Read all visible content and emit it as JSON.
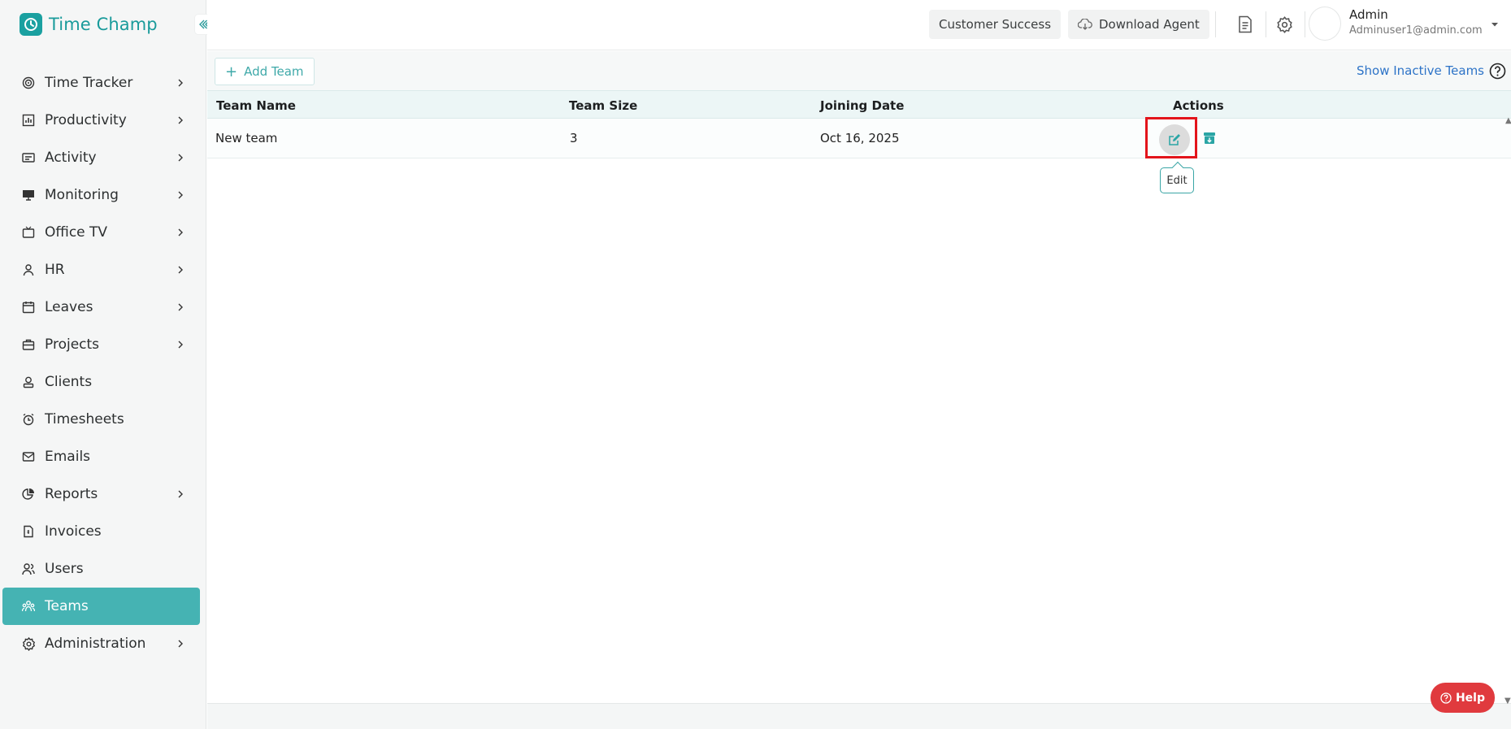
{
  "brand": {
    "name": "Time Champ",
    "color": "#1aa0a0"
  },
  "sidebar": {
    "items": [
      {
        "label": "Time Tracker",
        "icon": "time-tracker-icon",
        "has_children": true
      },
      {
        "label": "Productivity",
        "icon": "productivity-icon",
        "has_children": true
      },
      {
        "label": "Activity",
        "icon": "activity-icon",
        "has_children": true
      },
      {
        "label": "Monitoring",
        "icon": "monitor-icon",
        "has_children": true
      },
      {
        "label": "Office TV",
        "icon": "tv-icon",
        "has_children": true
      },
      {
        "label": "HR",
        "icon": "person-icon",
        "has_children": true
      },
      {
        "label": "Leaves",
        "icon": "calendar-icon",
        "has_children": true
      },
      {
        "label": "Projects",
        "icon": "briefcase-icon",
        "has_children": true
      },
      {
        "label": "Clients",
        "icon": "client-icon",
        "has_children": false
      },
      {
        "label": "Timesheets",
        "icon": "alarm-clock-icon",
        "has_children": false
      },
      {
        "label": "Emails",
        "icon": "mail-icon",
        "has_children": false
      },
      {
        "label": "Reports",
        "icon": "pie-chart-icon",
        "has_children": true
      },
      {
        "label": "Invoices",
        "icon": "invoice-icon",
        "has_children": false
      },
      {
        "label": "Users",
        "icon": "users-icon",
        "has_children": false
      },
      {
        "label": "Teams",
        "icon": "teams-icon",
        "has_children": false,
        "active": true
      },
      {
        "label": "Administration",
        "icon": "gear-icon",
        "has_children": true
      }
    ],
    "active_color": "#45b3b3"
  },
  "header": {
    "customer_success_label": "Customer Success",
    "download_agent_label": "Download Agent",
    "user": {
      "name": "Admin",
      "email": "Adminuser1@admin.com"
    }
  },
  "toolbar": {
    "add_team_label": "Add Team",
    "show_inactive_label": "Show Inactive Teams"
  },
  "table": {
    "columns": [
      "Team Name",
      "Team Size",
      "Joining Date",
      "Actions"
    ],
    "rows": [
      {
        "team_name": "New team",
        "team_size": "3",
        "joining_date": "Oct 16, 2025"
      }
    ]
  },
  "tooltip": {
    "text": "Edit"
  },
  "help_button": {
    "label": "Help",
    "color": "#e03a3e"
  }
}
